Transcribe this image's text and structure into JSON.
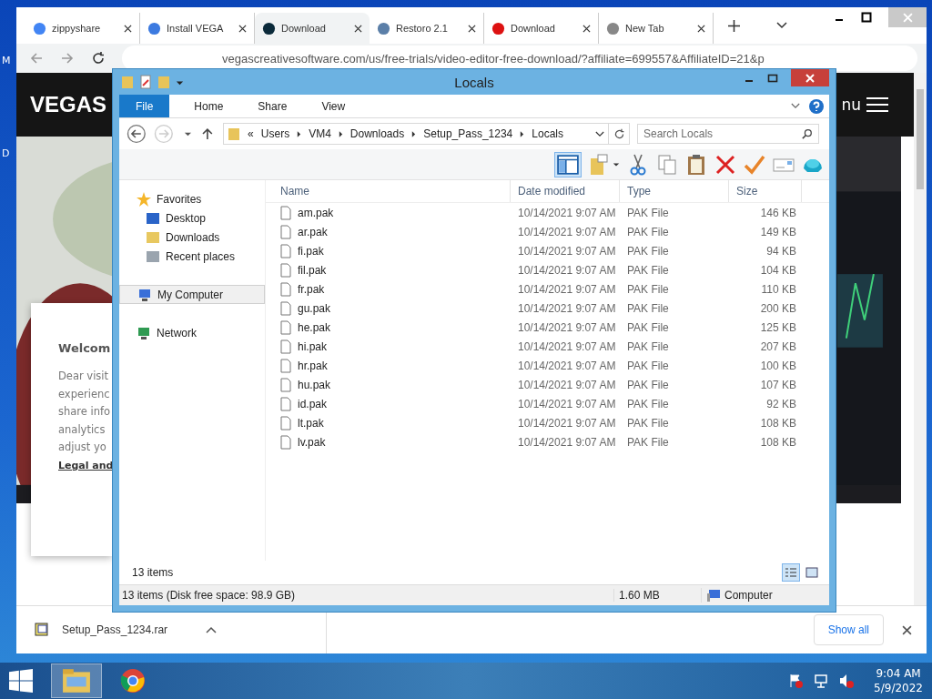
{
  "desktop": {
    "fragments": [
      "M",
      "D"
    ]
  },
  "browser": {
    "tabs": [
      {
        "label": "zippyshare",
        "selected": false
      },
      {
        "label": "Install VEGA",
        "selected": false
      },
      {
        "label": "Download",
        "selected": true
      },
      {
        "label": "Restoro 2.1",
        "selected": false
      },
      {
        "label": "Download",
        "selected": false
      },
      {
        "label": "New Tab",
        "selected": false
      }
    ],
    "address": "vegascreativesoftware.com/us/free-trials/video-editor-free-download/?affiliate=699557&AffiliateID=21&p",
    "page": {
      "logo": "VEGAS",
      "menu_label": "nu",
      "cookie": {
        "title": "Welcom",
        "lines": [
          "Dear visit",
          "experienc",
          "share info",
          "analytics",
          "adjust yo"
        ],
        "link": "Legal and"
      }
    },
    "downloads": {
      "file": "Setup_Pass_1234.rar",
      "show_all": "Show all"
    }
  },
  "explorer": {
    "title": "Locals",
    "ribbon_tabs": [
      {
        "label": "File",
        "selected": true
      },
      {
        "label": "Home",
        "selected": false
      },
      {
        "label": "Share",
        "selected": false
      },
      {
        "label": "View",
        "selected": false
      }
    ],
    "path_prefix": "«",
    "path": [
      "Users",
      "VM4",
      "Downloads",
      "Setup_Pass_1234",
      "Locals"
    ],
    "search": {
      "placeholder": "Search Locals"
    },
    "nav": [
      {
        "label": "Favorites",
        "kind": "favorites",
        "selected": false,
        "children": [
          {
            "label": "Desktop",
            "kind": "desktop",
            "selected": false
          },
          {
            "label": "Downloads",
            "kind": "downloads",
            "selected": false
          },
          {
            "label": "Recent places",
            "kind": "recent",
            "selected": false
          }
        ]
      },
      {
        "label": "My Computer",
        "kind": "computer",
        "selected": true
      },
      {
        "label": "Network",
        "kind": "network",
        "selected": false
      }
    ],
    "columns": [
      "Name",
      "Date modified",
      "Type",
      "Size"
    ],
    "files": [
      {
        "name": "am.pak",
        "modified": "10/14/2021 9:07 AM",
        "type": "PAK File",
        "size": "146 KB"
      },
      {
        "name": "ar.pak",
        "modified": "10/14/2021 9:07 AM",
        "type": "PAK File",
        "size": "149 KB"
      },
      {
        "name": "fi.pak",
        "modified": "10/14/2021 9:07 AM",
        "type": "PAK File",
        "size": "94 KB"
      },
      {
        "name": "fil.pak",
        "modified": "10/14/2021 9:07 AM",
        "type": "PAK File",
        "size": "104 KB"
      },
      {
        "name": "fr.pak",
        "modified": "10/14/2021 9:07 AM",
        "type": "PAK File",
        "size": "110 KB"
      },
      {
        "name": "gu.pak",
        "modified": "10/14/2021 9:07 AM",
        "type": "PAK File",
        "size": "200 KB"
      },
      {
        "name": "he.pak",
        "modified": "10/14/2021 9:07 AM",
        "type": "PAK File",
        "size": "125 KB"
      },
      {
        "name": "hi.pak",
        "modified": "10/14/2021 9:07 AM",
        "type": "PAK File",
        "size": "207 KB"
      },
      {
        "name": "hr.pak",
        "modified": "10/14/2021 9:07 AM",
        "type": "PAK File",
        "size": "100 KB"
      },
      {
        "name": "hu.pak",
        "modified": "10/14/2021 9:07 AM",
        "type": "PAK File",
        "size": "107 KB"
      },
      {
        "name": "id.pak",
        "modified": "10/14/2021 9:07 AM",
        "type": "PAK File",
        "size": "92 KB"
      },
      {
        "name": "lt.pak",
        "modified": "10/14/2021 9:07 AM",
        "type": "PAK File",
        "size": "108 KB"
      },
      {
        "name": "lv.pak",
        "modified": "10/14/2021 9:07 AM",
        "type": "PAK File",
        "size": "108 KB"
      }
    ],
    "item_count": "13 items",
    "status": {
      "summary": "13 items (Disk free space: 98.9 GB)",
      "size": "1.60 MB",
      "location": "Computer"
    }
  },
  "taskbar": {
    "time": "9:04 AM",
    "date": "5/9/2022"
  }
}
